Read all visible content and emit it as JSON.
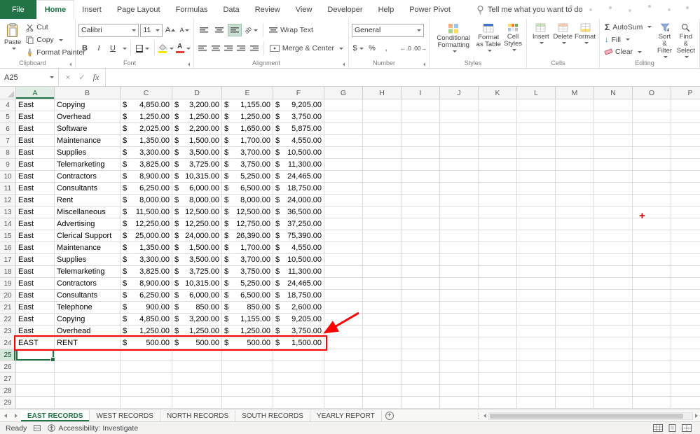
{
  "ribbon": {
    "tabs": [
      {
        "label": "File"
      },
      {
        "label": "Home",
        "active": true
      },
      {
        "label": "Insert"
      },
      {
        "label": "Page Layout"
      },
      {
        "label": "Formulas"
      },
      {
        "label": "Data"
      },
      {
        "label": "Review"
      },
      {
        "label": "View"
      },
      {
        "label": "Developer"
      },
      {
        "label": "Help"
      },
      {
        "label": "Power Pivot"
      }
    ],
    "tell_me": "Tell me what you want to do",
    "clipboard": {
      "label": "Clipboard",
      "paste": "Paste",
      "cut": "Cut",
      "copy": "Copy",
      "format_painter": "Format Painter"
    },
    "font": {
      "label": "Font",
      "name": "Calibri",
      "size": "11",
      "bold": "B",
      "italic": "I",
      "underline": "U",
      "grow": "A",
      "shrink": "A",
      "font_color_letter": "A",
      "font_color_hex": "#e03c31"
    },
    "alignment": {
      "label": "Alignment",
      "wrap_text": "Wrap Text",
      "merge_center": "Merge & Center",
      "orientation": "ab"
    },
    "number": {
      "label": "Number",
      "format": "General",
      "accounting": "$",
      "percent": "%",
      "comma": ",",
      "increase_decimal": "←.0",
      "decrease_decimal": ".00→"
    },
    "styles": {
      "label": "Styles",
      "conditional": "Conditional Formatting",
      "format_table": "Format as Table",
      "cell_styles": "Cell Styles"
    },
    "cells": {
      "label": "Cells",
      "insert": "Insert",
      "delete": "Delete",
      "format": "Format"
    },
    "editing": {
      "label": "Editing",
      "autosum": "AutoSum",
      "autosum_sigma": "Σ",
      "fill": "Fill",
      "fill_arrow": "↓",
      "clear": "Clear",
      "sort_filter": "Sort & Filter",
      "find_select": "Find & Select"
    }
  },
  "formula_bar": {
    "name_box": "A25",
    "cancel": "×",
    "enter": "✓",
    "fx": "fx",
    "formula": ""
  },
  "grid": {
    "columns": [
      "A",
      "B",
      "C",
      "D",
      "E",
      "F",
      "G",
      "H",
      "I",
      "J",
      "K",
      "L",
      "M",
      "N",
      "O",
      "P"
    ],
    "first_row": 4,
    "last_row": 29,
    "selected_cell": "A25",
    "currency_symbol": "$",
    "rows": [
      {
        "n": 4,
        "A": "East",
        "B": "Copying",
        "C": "4,850.00",
        "D": "3,200.00",
        "E": "1,155.00",
        "F": "9,205.00"
      },
      {
        "n": 5,
        "A": "East",
        "B": "Overhead",
        "C": "1,250.00",
        "D": "1,250.00",
        "E": "1,250.00",
        "F": "3,750.00"
      },
      {
        "n": 6,
        "A": "East",
        "B": "Software",
        "C": "2,025.00",
        "D": "2,200.00",
        "E": "1,650.00",
        "F": "5,875.00"
      },
      {
        "n": 7,
        "A": "East",
        "B": "Maintenance",
        "C": "1,350.00",
        "D": "1,500.00",
        "E": "1,700.00",
        "F": "4,550.00"
      },
      {
        "n": 8,
        "A": "East",
        "B": "Supplies",
        "C": "3,300.00",
        "D": "3,500.00",
        "E": "3,700.00",
        "F": "10,500.00"
      },
      {
        "n": 9,
        "A": "East",
        "B": "Telemarketing",
        "C": "3,825.00",
        "D": "3,725.00",
        "E": "3,750.00",
        "F": "11,300.00"
      },
      {
        "n": 10,
        "A": "East",
        "B": "Contractors",
        "C": "8,900.00",
        "D": "10,315.00",
        "E": "5,250.00",
        "F": "24,465.00"
      },
      {
        "n": 11,
        "A": "East",
        "B": "Consultants",
        "C": "6,250.00",
        "D": "6,000.00",
        "E": "6,500.00",
        "F": "18,750.00"
      },
      {
        "n": 12,
        "A": "East",
        "B": "Rent",
        "C": "8,000.00",
        "D": "8,000.00",
        "E": "8,000.00",
        "F": "24,000.00"
      },
      {
        "n": 13,
        "A": "East",
        "B": "Miscellaneous",
        "C": "11,500.00",
        "D": "12,500.00",
        "E": "12,500.00",
        "F": "36,500.00"
      },
      {
        "n": 14,
        "A": "East",
        "B": "Advertising",
        "C": "12,250.00",
        "D": "12,250.00",
        "E": "12,750.00",
        "F": "37,250.00"
      },
      {
        "n": 15,
        "A": "East",
        "B": "Clerical Support",
        "C": "25,000.00",
        "D": "24,000.00",
        "E": "26,390.00",
        "F": "75,390.00"
      },
      {
        "n": 16,
        "A": "East",
        "B": "Maintenance",
        "C": "1,350.00",
        "D": "1,500.00",
        "E": "1,700.00",
        "F": "4,550.00"
      },
      {
        "n": 17,
        "A": "East",
        "B": "Supplies",
        "C": "3,300.00",
        "D": "3,500.00",
        "E": "3,700.00",
        "F": "10,500.00"
      },
      {
        "n": 18,
        "A": "East",
        "B": "Telemarketing",
        "C": "3,825.00",
        "D": "3,725.00",
        "E": "3,750.00",
        "F": "11,300.00"
      },
      {
        "n": 19,
        "A": "East",
        "B": "Contractors",
        "C": "8,900.00",
        "D": "10,315.00",
        "E": "5,250.00",
        "F": "24,465.00"
      },
      {
        "n": 20,
        "A": "East",
        "B": "Consultants",
        "C": "6,250.00",
        "D": "6,000.00",
        "E": "6,500.00",
        "F": "18,750.00"
      },
      {
        "n": 21,
        "A": "East",
        "B": "Telephone",
        "C": "900.00",
        "D": "850.00",
        "E": "850.00",
        "F": "2,600.00"
      },
      {
        "n": 22,
        "A": "East",
        "B": "Copying",
        "C": "4,850.00",
        "D": "3,200.00",
        "E": "1,155.00",
        "F": "9,205.00"
      },
      {
        "n": 23,
        "A": "East",
        "B": "Overhead",
        "C": "1,250.00",
        "D": "1,250.00",
        "E": "1,250.00",
        "F": "3,750.00"
      },
      {
        "n": 24,
        "A": "EAST",
        "B": "RENT",
        "C": "500.00",
        "D": "500.00",
        "E": "500.00",
        "F": "1,500.00"
      }
    ]
  },
  "annotations": {
    "highlighted_row": 24,
    "plus_marker": "+"
  },
  "sheet_tabs": {
    "tabs": [
      {
        "label": "EAST RECORDS",
        "active": true
      },
      {
        "label": "WEST RECORDS"
      },
      {
        "label": "NORTH RECORDS"
      },
      {
        "label": "SOUTH RECORDS"
      },
      {
        "label": "YEARLY REPORT"
      }
    ],
    "add_sheet": "+"
  },
  "status_bar": {
    "mode": "Ready",
    "accessibility": "Accessibility: Investigate"
  }
}
